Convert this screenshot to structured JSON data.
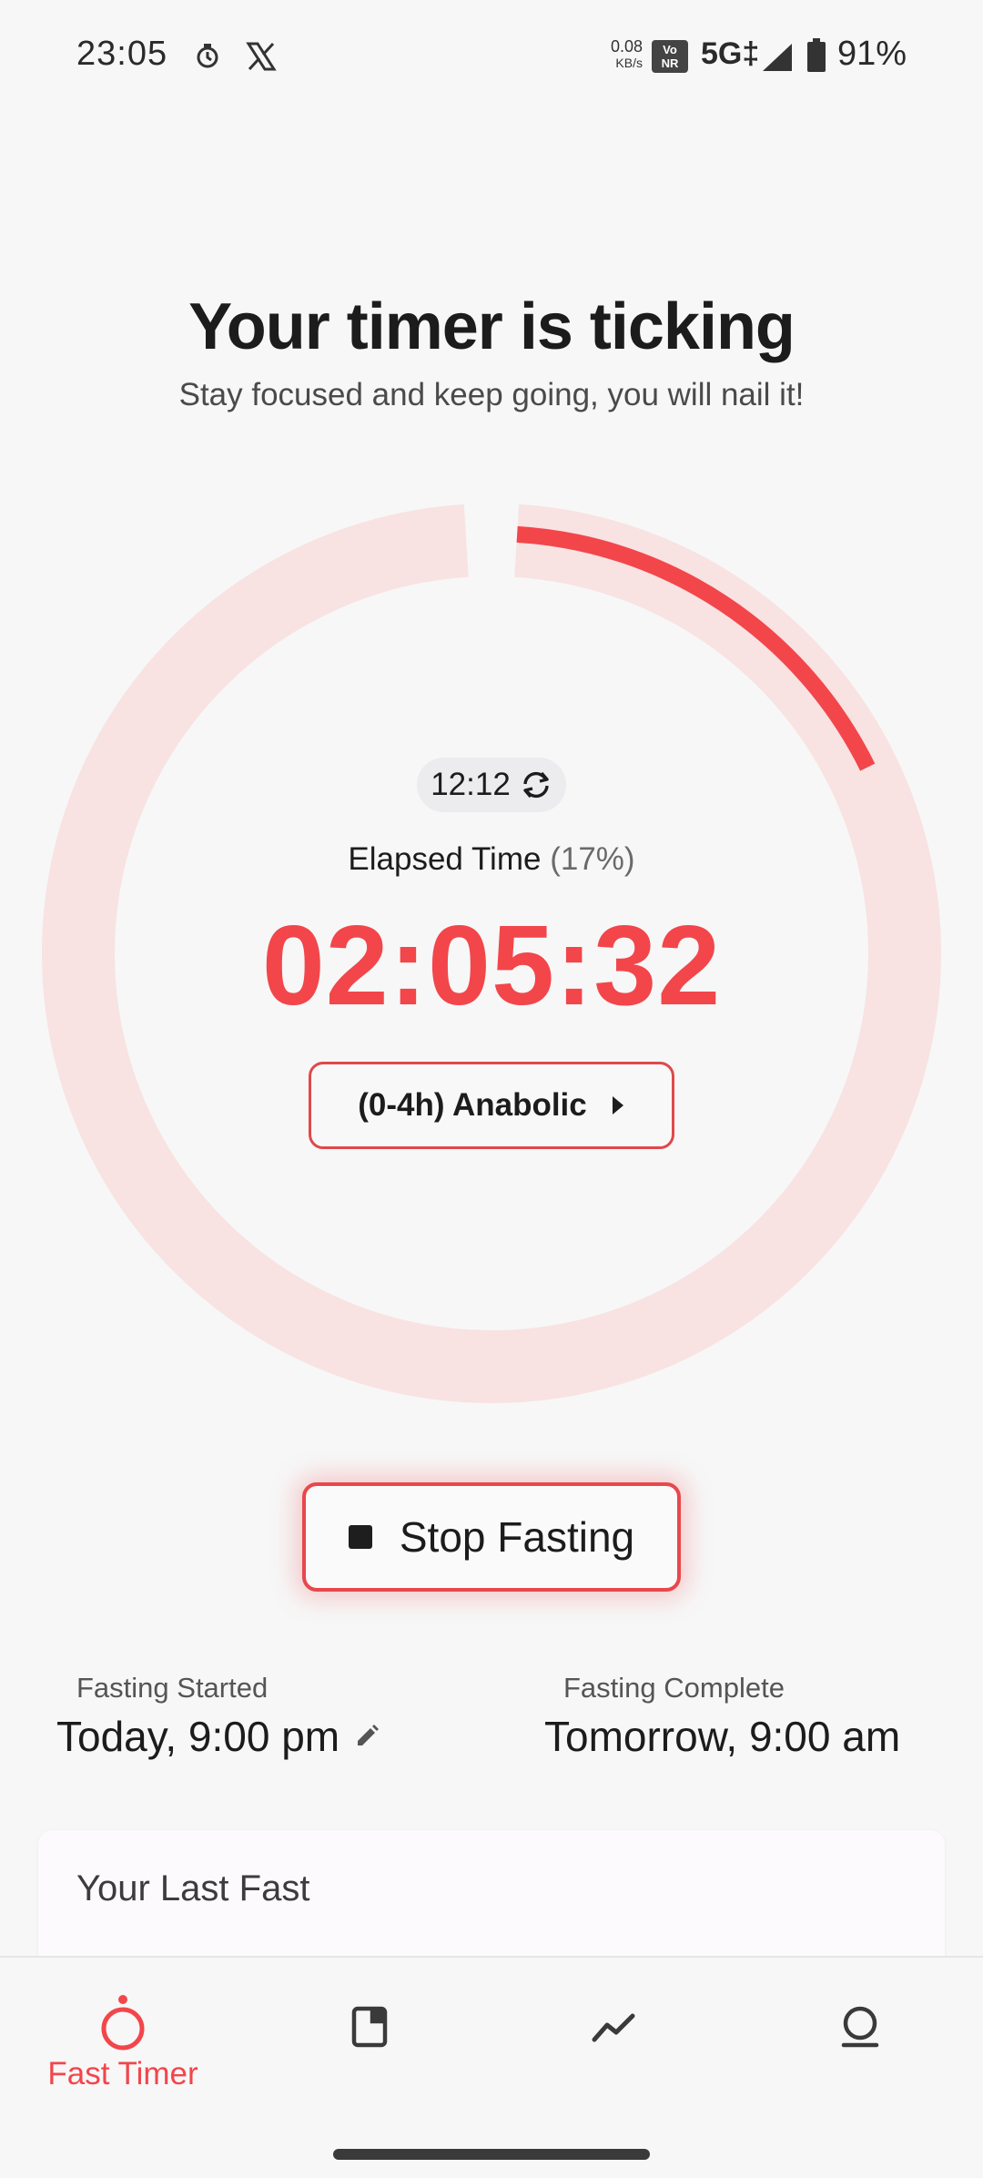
{
  "status_bar": {
    "time": "23:05",
    "net_speed_value": "0.08",
    "net_speed_unit": "KB/s",
    "volte_top": "Vo",
    "volte_bottom": "NR",
    "network": "5G‡",
    "battery": "91%",
    "icons": [
      "timer-notification-icon",
      "x-app-icon",
      "signal-icon",
      "battery-icon"
    ]
  },
  "header": {
    "title": "Your timer is ticking",
    "subtitle": "Stay focused and keep going, you will nail it!"
  },
  "timer": {
    "plan": "12:12",
    "elapsed_label": "Elapsed Time",
    "elapsed_percent_text": "(17%)",
    "progress_fraction": 0.17,
    "elapsed_time": "02:05:32",
    "stage_label": "(0-4h) Anabolic",
    "colors": {
      "accent": "#f2464b",
      "track": "#f8e2e2"
    }
  },
  "actions": {
    "stop_label": "Stop Fasting"
  },
  "fasting_info": {
    "started_label": "Fasting Started",
    "started_value": "Today, 9:00 pm",
    "complete_label": "Fasting Complete",
    "complete_value": "Tomorrow, 9:00 am"
  },
  "last_fast": {
    "title": "Your Last Fast"
  },
  "bottom_nav": {
    "items": [
      {
        "label": "Fast Timer",
        "icon": "timer-icon",
        "active": true
      },
      {
        "label": "",
        "icon": "journal-icon",
        "active": false
      },
      {
        "label": "",
        "icon": "trend-chart-icon",
        "active": false
      },
      {
        "label": "",
        "icon": "profile-icon",
        "active": false
      }
    ]
  }
}
